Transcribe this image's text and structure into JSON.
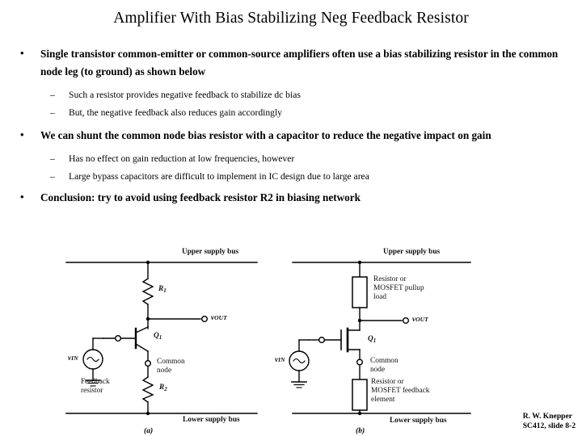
{
  "slide": {
    "title": "Amplifier With Bias Stabilizing Neg Feedback Resistor",
    "bullets": [
      {
        "level": 1,
        "marker": "•",
        "text": "Single transistor common-emitter or common-source amplifiers often use a bias stabilizing resistor in the common node leg (to ground) as shown below"
      },
      {
        "level": 2,
        "marker": "–",
        "text": "Such a resistor provides negative feedback to stabilize dc bias"
      },
      {
        "level": 2,
        "marker": "–",
        "text": "But, the negative feedback also reduces gain accordingly"
      },
      {
        "level": 1,
        "marker": "•",
        "text": "We can shunt the common node bias resistor with a capacitor to reduce the negative impact on gain"
      },
      {
        "level": 2,
        "marker": "–",
        "text": "Has no effect on gain reduction at low frequencies, however"
      },
      {
        "level": 2,
        "marker": "–",
        "text": "Large bypass capacitors are difficult to implement in IC design due to large area"
      },
      {
        "level": 1,
        "marker": "•",
        "text": "Conclusion:  try to avoid using feedback resistor R2 in biasing network"
      }
    ]
  },
  "figure": {
    "panel_a": {
      "caption": "(a)",
      "upper_bus": "Upper supply bus",
      "lower_bus": "Lower supply bus",
      "load_resistor": "R",
      "load_resistor_sub": "1",
      "transistor": "Q",
      "transistor_sub": "1",
      "output_label": "v",
      "output_label_sub": "OUT",
      "input_label": "v",
      "input_label_sub": "IN",
      "common_node_line1": "Common",
      "common_node_line2": "node",
      "feedback_line1": "Feedback",
      "feedback_line2": "resistor",
      "feedback_resistor": "R",
      "feedback_resistor_sub": "2"
    },
    "panel_b": {
      "caption": "(b)",
      "upper_bus": "Upper supply bus",
      "lower_bus": "Lower supply bus",
      "pullup_line1": "Resistor or",
      "pullup_line2": "MOSFET pullup",
      "pullup_line3": "load",
      "transistor": "Q",
      "transistor_sub": "1",
      "output_label": "v",
      "output_label_sub": "OUT",
      "input_label": "v",
      "input_label_sub": "IN",
      "common_node_line1": "Common",
      "common_node_line2": "node",
      "feedback_line1": "Resistor or",
      "feedback_line2": "MOSFET feedback",
      "feedback_line3": "element"
    }
  },
  "credit": {
    "author": "R. W. Knepper",
    "course": "SC412, slide 8-2"
  },
  "colors": {
    "ink": "#000000",
    "background": "#ffffff"
  }
}
